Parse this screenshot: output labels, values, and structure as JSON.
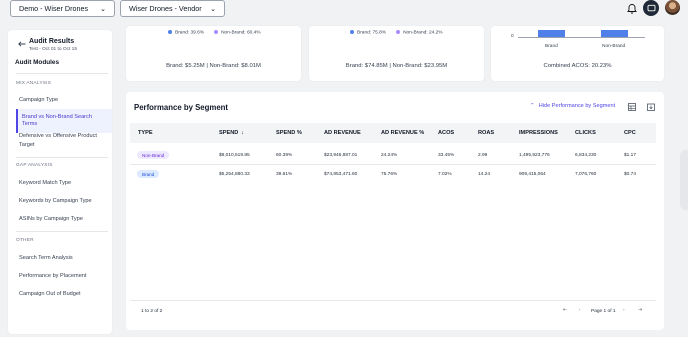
{
  "header": {
    "account_select": "Demo - Wiser Drones",
    "vendor_select": "Wiser Drones - Vendor"
  },
  "sidebar": {
    "back_icon": "arrow-left-icon",
    "title": "Audit Results",
    "subtitle": "Test - Oct 01 to Oct 15",
    "modules_title": "Audit Modules",
    "sections": [
      {
        "label": "MIX ANALYSIS",
        "items": [
          "Campaign Type",
          "Brand vs Non-Brand Search Terms",
          "Defensive vs Offensive Product Target"
        ]
      },
      {
        "label": "GAP ANALYSIS",
        "items": [
          "Keyword Match Type",
          "Keywords by Campaign Type",
          "ASINs by Campaign Type"
        ]
      },
      {
        "label": "OTHER",
        "items": [
          "Search Term Analysis",
          "Performance by Placement",
          "Campaign Out of Budget"
        ]
      }
    ],
    "active_item": "Brand vs Non-Brand Search Terms"
  },
  "cards": [
    {
      "legend": [
        "Brand: 39.6%",
        "Non-Brand: 60.4%"
      ],
      "summary": "Brand: $5.25M | Non-Brand: $8.01M"
    },
    {
      "legend": [
        "Brand: 75.8%",
        "Non-Brand: 24.2%"
      ],
      "summary": "Brand: $74.85M | Non-Brand: $23.95M"
    },
    {
      "axis_zero": "0",
      "x_labels": [
        "Brand",
        "Non-Brand"
      ],
      "summary": "Combined ACOS: 20.23%"
    }
  ],
  "colors": {
    "brand": "#4f7fe8",
    "nonbrand": "#a78bfa",
    "accent": "#4f46e5",
    "nonbrand_pill_bg": "#ede9fe",
    "nonbrand_pill_fg": "#6d28d9",
    "brand_pill_bg": "#dbeafe",
    "brand_pill_fg": "#1d4ed8"
  },
  "segment": {
    "title": "Performance by Segment",
    "hide_label": "Hide Performance by Segment",
    "columns": [
      "TYPE",
      "SPEND",
      "SPEND %",
      "AD REVENUE",
      "AD REVENUE %",
      "ACOS",
      "ROAS",
      "IMPRESSIONS",
      "CLICKS",
      "CPC"
    ],
    "sort_icon": "arrow-down-icon",
    "rows": [
      {
        "type": "Non-Brand",
        "spend": "$8,010,519.85",
        "spend_pct": "60.39%",
        "ad_revenue": "$23,946,887.01",
        "ad_revenue_pct": "24.24%",
        "acos": "33.45%",
        "roas": "2.99",
        "impressions": "1,495,923,776",
        "clicks": "6,834,230",
        "cpc": "$1.17"
      },
      {
        "type": "Brand",
        "spend": "$5,254,880.33",
        "spend_pct": "39.61%",
        "ad_revenue": "$74,853,471.60",
        "ad_revenue_pct": "75.76%",
        "acos": "7.02%",
        "roas": "14.24",
        "impressions": "909,415,064",
        "clicks": "7,076,760",
        "cpc": "$0.74"
      }
    ],
    "footer": {
      "range": "1 to 2 of 2",
      "page": "Page 1 of 1"
    }
  }
}
